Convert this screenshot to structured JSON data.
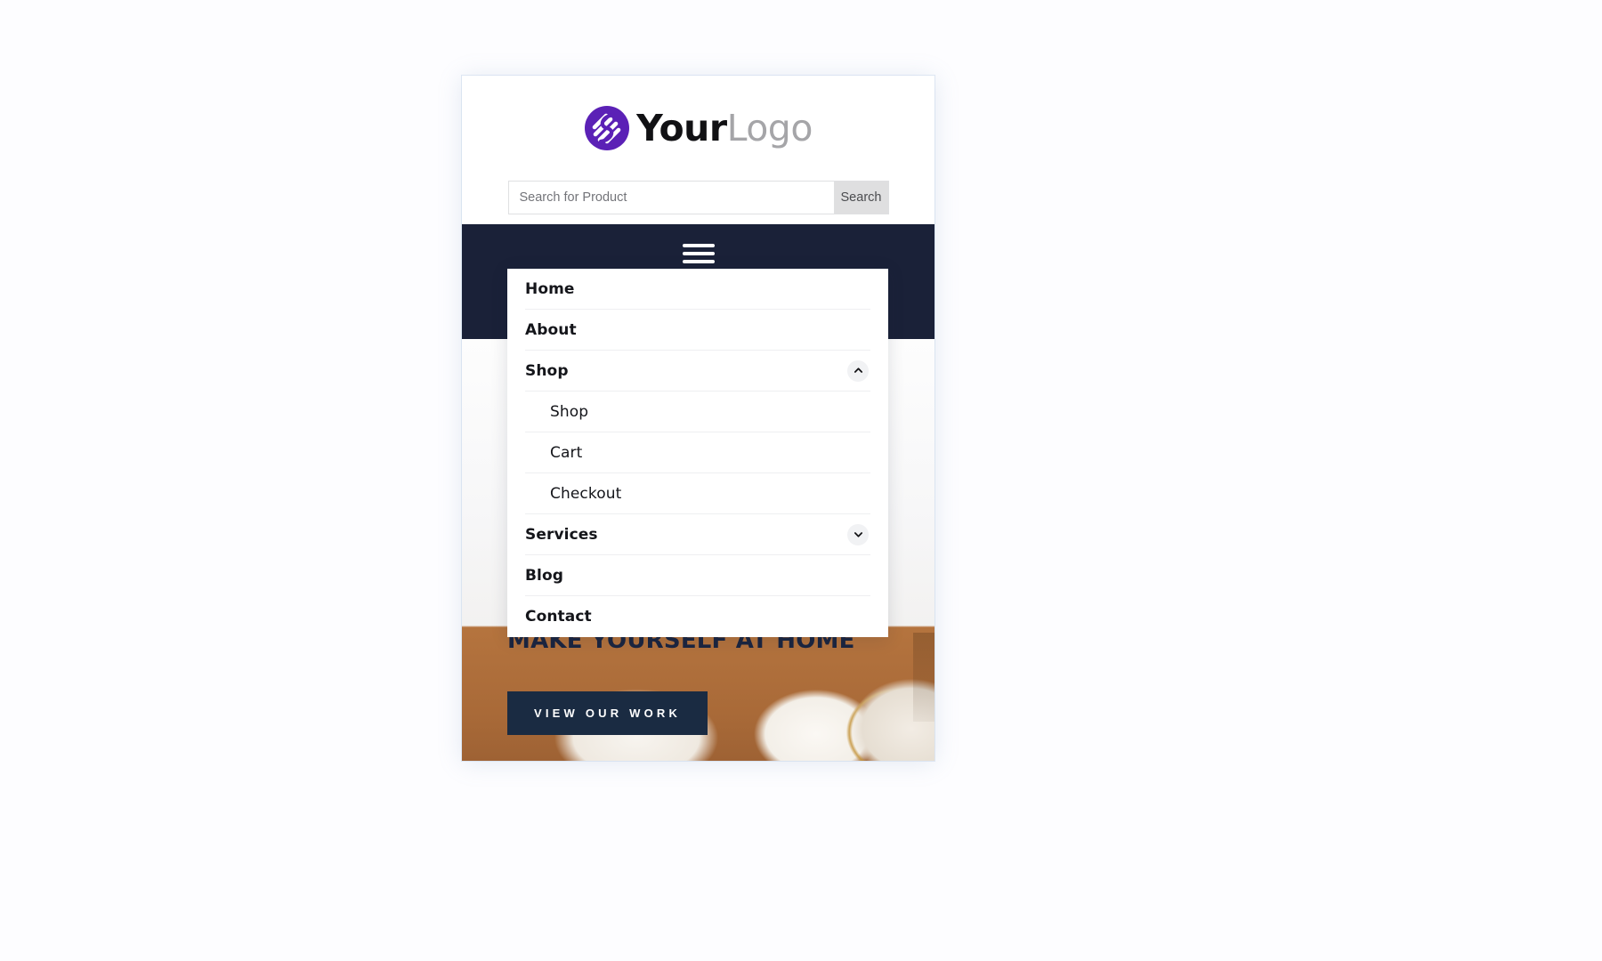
{
  "page": {
    "background_color": "#fdfdff"
  },
  "header": {
    "logo": {
      "icon_name": "brand-swirl-logo-icon",
      "primary_text": "Your",
      "secondary_text": "Logo",
      "primary_color": "#111114",
      "secondary_color": "#a5a5a8",
      "mark_color": "#5b21b6"
    },
    "search": {
      "placeholder": "Search for Product",
      "value": "",
      "button_label": "Search",
      "button_bg": "#dfdfe0"
    }
  },
  "navbar": {
    "background_color": "#1a2138",
    "menu_toggle_name": "hamburger-menu-button",
    "menu_toggle_state": "open"
  },
  "menu": {
    "items": [
      {
        "label": "Home",
        "level": "top",
        "expander": null
      },
      {
        "label": "About",
        "level": "top",
        "expander": null
      },
      {
        "label": "Shop",
        "level": "top",
        "expander": "chevron-up"
      },
      {
        "label": "Shop",
        "level": "sub",
        "expander": null
      },
      {
        "label": "Cart",
        "level": "sub",
        "expander": null
      },
      {
        "label": "Checkout",
        "level": "sub",
        "expander": null
      },
      {
        "label": "Services",
        "level": "top",
        "expander": "chevron-down"
      },
      {
        "label": "Blog",
        "level": "top",
        "expander": null
      },
      {
        "label": "Contact",
        "level": "top",
        "expander": null
      }
    ]
  },
  "hero": {
    "heading": "MAKE YOURSELF AT HOME",
    "heading_color": "#1b2540",
    "cta_label": "VIEW OUR WORK",
    "cta_bg": "#1a2b42",
    "image_description": "living room with tan leather sofa, white curtains and decorative pillows"
  }
}
